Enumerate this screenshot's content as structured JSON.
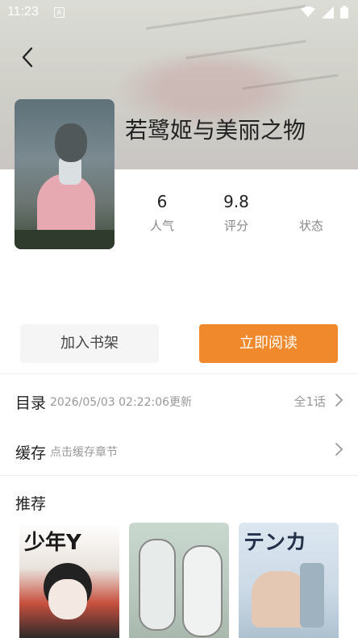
{
  "status_bar": {
    "time": "11:23",
    "a_badge": "A"
  },
  "detail": {
    "title": "若鹭姬与美丽之物",
    "stats": [
      {
        "value": "6",
        "label": "人气"
      },
      {
        "value": "9.8",
        "label": "评分"
      },
      {
        "value": "",
        "label": "状态"
      }
    ]
  },
  "actions": {
    "add_shelf": "加入书架",
    "read_now": "立即阅读"
  },
  "catalog": {
    "label": "目录",
    "updated": "2026/05/03 02:22:06更新",
    "count": "全1话"
  },
  "cache": {
    "label": "缓存",
    "hint": "点击缓存章节"
  },
  "recommend": {
    "title": "推荐",
    "items": [
      {
        "cover_text": "少年Y"
      },
      {
        "cover_text": ""
      },
      {
        "cover_text": "テンカ"
      }
    ]
  },
  "colors": {
    "accent": "#f0892b",
    "shelf_bg": "#f5f5f5"
  }
}
